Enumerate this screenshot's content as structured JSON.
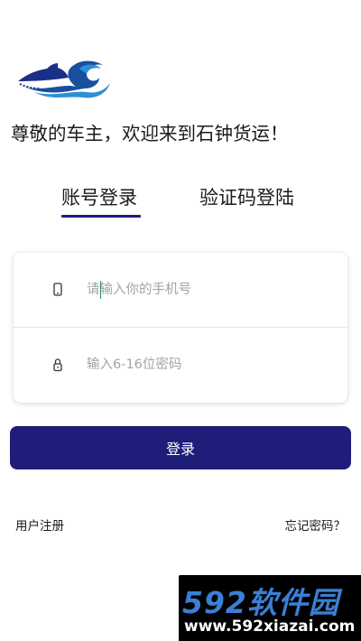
{
  "welcome": {
    "text": "尊敬的车主，欢迎来到石钟货运！"
  },
  "tabs": [
    {
      "label": "账号登录",
      "active": true
    },
    {
      "label": "验证码登陆",
      "active": false
    }
  ],
  "form": {
    "phone": {
      "placeholder": "请输入你的手机号",
      "value": "",
      "icon": "phone-icon"
    },
    "password": {
      "placeholder": "输入6-16位密码",
      "value": "",
      "icon": "lock-icon"
    }
  },
  "login_button": {
    "label": "登录"
  },
  "links": {
    "register": "用户注册",
    "forgot": "忘记密码？"
  },
  "watermark": {
    "brand": "592软件园",
    "url": "www.592xiazai.com"
  },
  "colors": {
    "primary": "#1e1d7a",
    "logo_blue": "#1a4fa0",
    "watermark_blue": "#3b7fd6"
  }
}
